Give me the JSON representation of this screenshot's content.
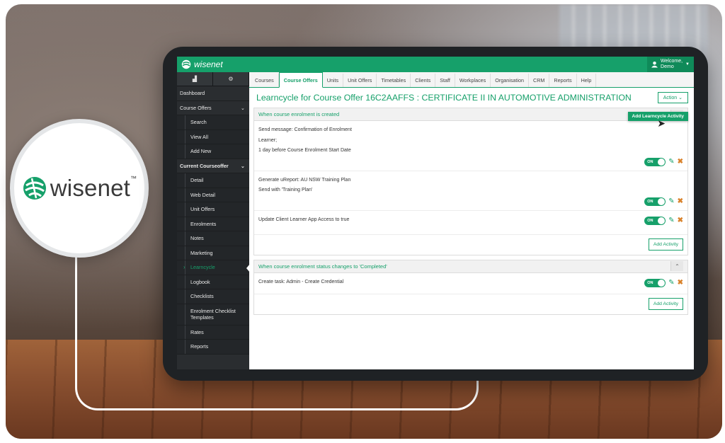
{
  "brand": {
    "logo_text": "wisenet",
    "logo_mark": "™",
    "app_name": "wisenet"
  },
  "user": {
    "welcome": "Welcome,",
    "name": "Demo"
  },
  "sidebar": {
    "items": [
      {
        "label": "Dashboard",
        "type": "item"
      },
      {
        "label": "Course Offers",
        "type": "item",
        "chevron": true
      },
      {
        "label": "Search",
        "type": "sub"
      },
      {
        "label": "View All",
        "type": "sub"
      },
      {
        "label": "Add New",
        "type": "sub"
      },
      {
        "label": "Current Courseoffer",
        "type": "head",
        "chevron": true
      },
      {
        "label": "Detail",
        "type": "sub"
      },
      {
        "label": "Web Detail",
        "type": "sub"
      },
      {
        "label": "Unit Offers",
        "type": "sub"
      },
      {
        "label": "Enrolments",
        "type": "sub"
      },
      {
        "label": "Notes",
        "type": "sub"
      },
      {
        "label": "Marketing",
        "type": "sub"
      },
      {
        "label": "Learncycle",
        "type": "sub",
        "active": true
      },
      {
        "label": "Logbook",
        "type": "sub"
      },
      {
        "label": "Checklists",
        "type": "sub"
      },
      {
        "label": "Enrolment Checklist Templates",
        "type": "sub",
        "tall": true
      },
      {
        "label": "Rates",
        "type": "sub"
      },
      {
        "label": "Reports",
        "type": "sub"
      }
    ]
  },
  "tabs": [
    "Courses",
    "Course Offers",
    "Units",
    "Unit Offers",
    "Timetables",
    "Clients",
    "Staff",
    "Workplaces",
    "Organisation",
    "CRM",
    "Reports",
    "Help"
  ],
  "active_tab": "Course Offers",
  "page": {
    "title": "Learncycle for Course Offer 16C2AAFFS : CERTIFICATE II IN AUTOMOTIVE ADMINISTRATION",
    "action_label": "Action",
    "dropdown_item": "Add Learncycle Activity"
  },
  "panels": [
    {
      "header": "When course enrolment is created",
      "activities": [
        {
          "lines": [
            "Send message: Confirmation of Enrolment",
            "Learner;",
            "1 day before Course Enrolment Start Date"
          ],
          "toggle": "ON"
        },
        {
          "lines": [
            "Generate uReport: AU NSW Training Plan",
            "Send with 'Training Plan'"
          ],
          "toggle": "ON"
        },
        {
          "lines": [
            "Update Client Learner App Access to true"
          ],
          "toggle": "ON"
        }
      ],
      "add_label": "Add Activity"
    },
    {
      "header": "When course enrolment status changes to 'Completed'",
      "activities": [
        {
          "lines": [
            "Create task: Admin - Create Credential"
          ],
          "toggle": "ON"
        }
      ],
      "add_label": "Add Activity"
    }
  ],
  "colors": {
    "accent": "#16a06a",
    "sidebar": "#2a2d30",
    "delete": "#d9822b"
  },
  "icons": [
    "signal-icon",
    "settings-icon",
    "user-icon",
    "chevron-down-icon",
    "pencil-icon",
    "delete-icon",
    "collapse-icon",
    "cursor-icon"
  ]
}
